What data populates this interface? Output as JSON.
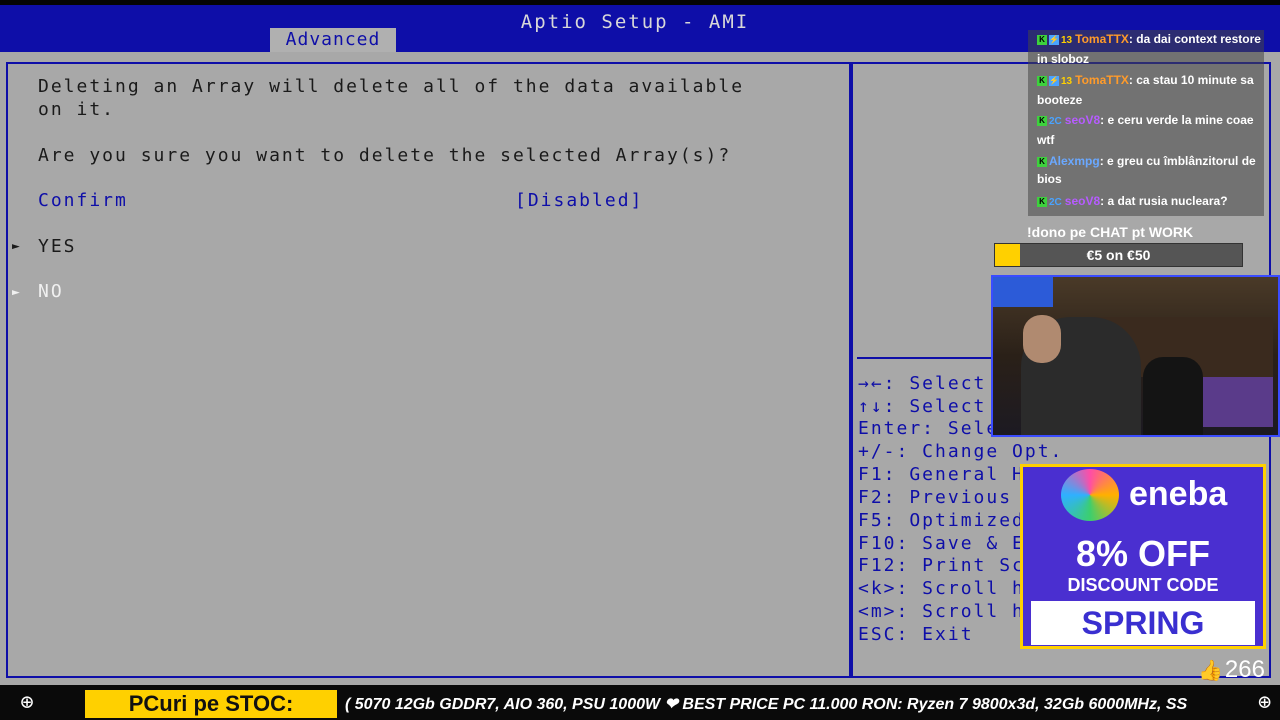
{
  "bios": {
    "title": "Aptio Setup - AMI",
    "tab": "Advanced",
    "warning_line1": "Deleting an Array will delete all of the data available",
    "warning_line2": "on it.",
    "question": "Are you sure you want to delete the selected Array(s)?",
    "confirm_label": "Confirm",
    "confirm_value": "[Disabled]",
    "options": [
      "YES",
      "NO"
    ],
    "arrow": "►",
    "help": [
      "→←: Select",
      "↑↓: Select",
      "Enter: Sele",
      "+/-: Change Opt.",
      "F1: General H",
      "F2: Previous",
      "F5: Optimized",
      "F10: Save & E",
      "F12: Print Sc",
      "<k>: Scroll h",
      "<m>: Scroll h",
      "ESC: Exit"
    ]
  },
  "chat": {
    "messages": [
      {
        "badges": [
          "K",
          "⚡"
        ],
        "level": "13",
        "user": "TomaTTX",
        "text": ": da dai context restore in sloboz"
      },
      {
        "badges": [
          "K",
          "⚡"
        ],
        "level": "13",
        "user": "TomaTTX",
        "text": ": ca stau 10 minute sa booteze"
      },
      {
        "badges": [
          "K"
        ],
        "level": "2C",
        "user": "seoV8",
        "text": ": e ceru verde la mine coae wtf"
      },
      {
        "badges": [
          "K"
        ],
        "level": "",
        "user": "Alexmpg",
        "text": ": e greu cu îmblânzitorul de bios"
      },
      {
        "badges": [
          "K"
        ],
        "level": "2C",
        "user": "seoV8",
        "text": ": a dat rusia nucleara?"
      }
    ]
  },
  "donation": {
    "label": "!dono pe CHAT pt WORK",
    "goal_text": "€5 on €50",
    "progress": 0.1
  },
  "ad": {
    "brand": "eneba",
    "discount": "8% OFF",
    "discount_label": "DISCOUNT CODE",
    "code": "SPRING"
  },
  "likes": "266",
  "ticker": {
    "badge": "PCuri pe STOC:",
    "text": "( 5070 12Gb GDDR7, AIO 360, PSU 1000W ❤ BEST PRICE PC 11.000 RON: Ryzen 7 9800x3d, 32Gb 6000MHz, SS"
  },
  "colors": {
    "bios_blue": "#0e0ea8",
    "bios_gray": "#a8a8a8",
    "accent_yellow": "#ffd000",
    "ad_purple": "#4a2fd0"
  }
}
